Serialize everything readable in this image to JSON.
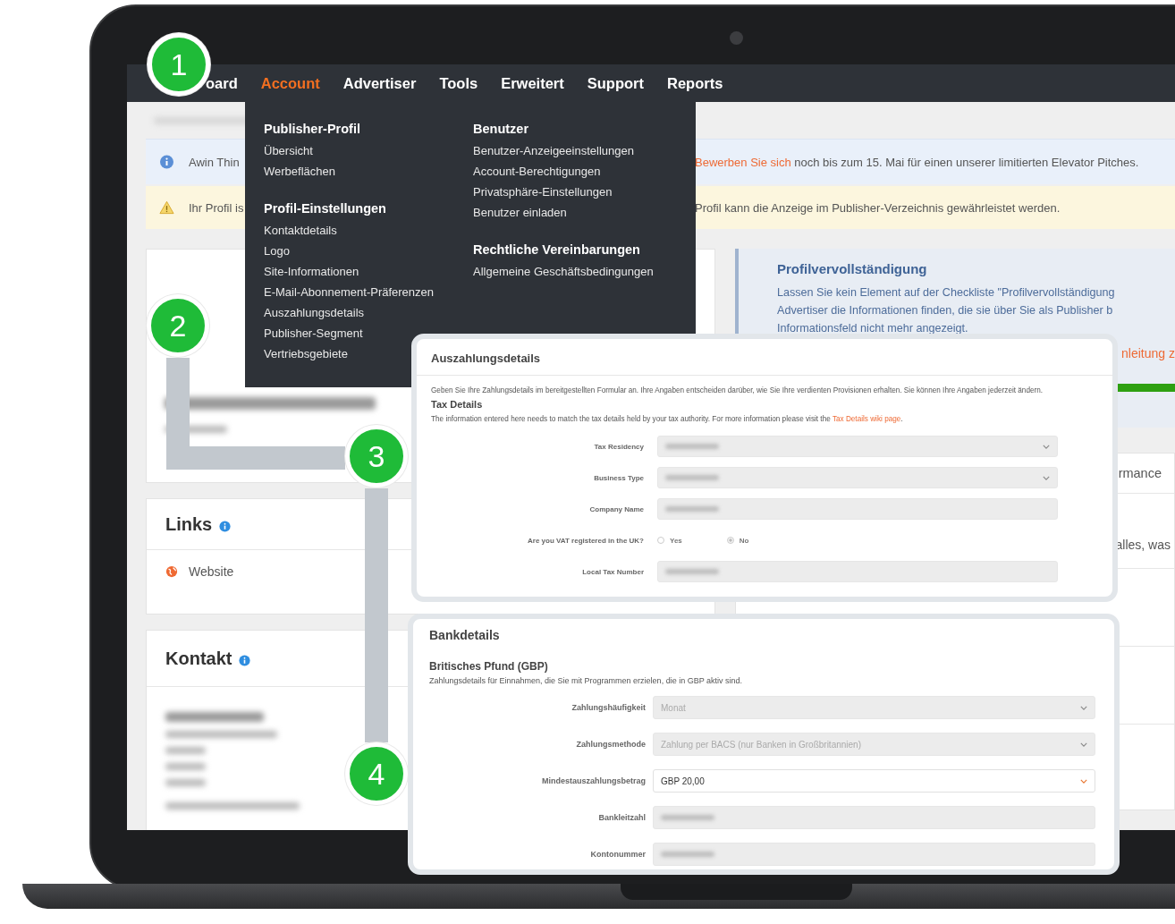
{
  "nav": {
    "items": [
      {
        "label": "oard",
        "selected": false
      },
      {
        "label": "Account",
        "selected": true
      },
      {
        "label": "Advertiser",
        "selected": false
      },
      {
        "label": "Tools",
        "selected": false
      },
      {
        "label": "Erweitert",
        "selected": false
      },
      {
        "label": "Support",
        "selected": false
      },
      {
        "label": "Reports",
        "selected": false
      }
    ]
  },
  "dropdown": {
    "columns": [
      {
        "groups": [
          {
            "heading": "Publisher-Profil",
            "items": [
              "Übersicht",
              "Werbeflächen"
            ]
          },
          {
            "heading": "Profil-Einstellungen",
            "items": [
              "Kontaktdetails",
              "Logo",
              "Site-Informationen",
              "E-Mail-Abonnement-Präferenzen",
              "Auszahlungsdetails",
              "Publisher-Segment",
              "Vertriebsgebiete"
            ]
          }
        ]
      },
      {
        "groups": [
          {
            "heading": "Benutzer",
            "items": [
              "Benutzer-Anzeigeeinstellungen",
              "Account-Berechtigungen",
              "Privatsphäre-Einstellungen",
              "Benutzer einladen"
            ]
          },
          {
            "heading": "Rechtliche Vereinbarungen",
            "items": [
              "Allgemeine Geschäftsbedingungen"
            ]
          }
        ]
      }
    ]
  },
  "banners": [
    {
      "kind": "info",
      "left_text": "Awin Thin",
      "link": "Bewerben Sie sich",
      "text": "noch bis zum 15. Mai für einen unserer limitierten Elevator Pitches."
    },
    {
      "kind": "warning",
      "left_text": "Ihr Profil is",
      "text": "Profil kann die Anzeige im Publisher-Verzeichnis gewährleistet werden."
    }
  ],
  "links_card": {
    "title": "Links",
    "items": [
      {
        "label": "Website"
      }
    ]
  },
  "contact_card": {
    "title": "Kontakt"
  },
  "profile_completion": {
    "title": "Profilvervollständigung",
    "lines": [
      "Lassen Sie kein Element auf der Checkliste \"Profilvervollständigung",
      "Advertiser die Informationen finden, die sie über Sie als Publisher b",
      "Informationsfeld nicht mehr angezeigt."
    ],
    "link": "nleitung z",
    "level": 1
  },
  "right_card": {
    "heading": "rmance",
    "text": "alles, was"
  },
  "payout_panel": {
    "title": "Auszahlungsdetails",
    "intro": "Geben Sie Ihre Zahlungsdetails im bereitgestellten Formular an. Ihre Angaben entscheiden darüber, wie Sie Ihre verdienten Provisionen erhalten. Sie können Ihre Angaben jederzeit ändern.",
    "section": "Tax Details",
    "note": "The information entered here needs to match the tax details held by your tax authority. For more information please visit the",
    "note_link": "Tax Details wiki page",
    "note_end": ".",
    "fields": [
      {
        "label": "Tax Residency",
        "kind": "select",
        "disabled": true,
        "redacted": true
      },
      {
        "label": "Business Type",
        "kind": "select",
        "disabled": true,
        "redacted": true
      },
      {
        "label": "Company Name",
        "kind": "input",
        "disabled": true,
        "redacted": true
      },
      {
        "label": "Are you VAT registered in the UK?",
        "kind": "radio",
        "options": [
          {
            "label": "Yes",
            "selected": false
          },
          {
            "label": "No",
            "selected": true
          }
        ]
      },
      {
        "label": "Local Tax Number",
        "kind": "input",
        "disabled": true,
        "redacted": true
      }
    ]
  },
  "bank_panel": {
    "title": "Bankdetails",
    "section": "Britisches Pfund (GBP)",
    "note": "Zahlungsdetails für Einnahmen, die Sie mit Programmen erzielen, die in GBP aktiv sind.",
    "fields": [
      {
        "label": "Zahlungshäufigkeit",
        "kind": "select",
        "disabled": true,
        "value": "Monat"
      },
      {
        "label": "Zahlungsmethode",
        "kind": "select",
        "disabled": true,
        "value": "Zahlung per BACS (nur Banken in Großbritannien)"
      },
      {
        "label": "Mindestauszahlungsbetrag",
        "kind": "select",
        "disabled": false,
        "value": "GBP 20,00"
      },
      {
        "label": "Bankleitzahl",
        "kind": "input",
        "disabled": true,
        "redacted": true
      },
      {
        "label": "Kontonummer",
        "kind": "input",
        "disabled": true,
        "redacted": true
      }
    ]
  },
  "badges": [
    "1",
    "2",
    "3",
    "4"
  ]
}
